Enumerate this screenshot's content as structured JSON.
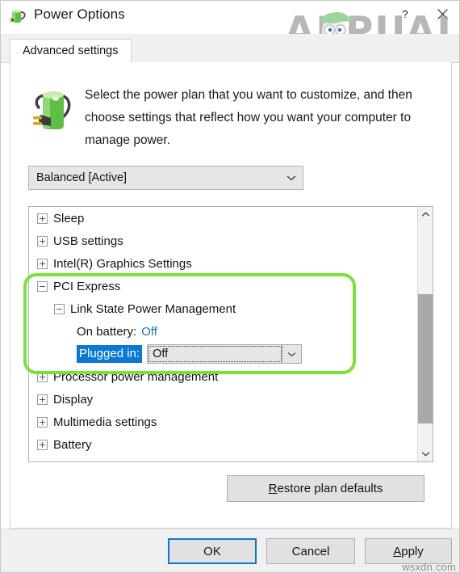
{
  "window": {
    "title": "Power Options",
    "title_icon": "battery-plug-icon",
    "help_button": "?",
    "close_button": "✕"
  },
  "watermark": {
    "text": "APPUALS",
    "face_icon": "appuals-mascot-icon",
    "color": "#9c9c9c",
    "hair_color": "#7ac27a"
  },
  "tabs": [
    {
      "label": "Advanced settings",
      "active": true
    }
  ],
  "header": {
    "icon": "battery-plug-large-icon",
    "description": "Select the power plan that you want to customize, and then choose settings that reflect how you want your computer to manage power."
  },
  "plan_select": {
    "value": "Balanced [Active]",
    "arrow_icon": "chevron-down-icon"
  },
  "tree": {
    "rows": [
      {
        "level": 0,
        "toggle": "plus",
        "label": "Sleep"
      },
      {
        "level": 0,
        "toggle": "plus",
        "label": "USB settings"
      },
      {
        "level": 0,
        "toggle": "plus",
        "label": "Intel(R) Graphics Settings"
      },
      {
        "level": 0,
        "toggle": "minus",
        "label": "PCI Express"
      },
      {
        "level": 1,
        "toggle": "minus",
        "label": "Link State Power Management"
      },
      {
        "level": 2,
        "toggle": "none",
        "label": "On battery:",
        "value": "Off",
        "value_style": "blue"
      },
      {
        "level": 2,
        "toggle": "none",
        "label": "Plugged in:",
        "selected": true,
        "combo_value": "Off",
        "combo_arrow": "chevron-down-icon"
      },
      {
        "level": 0,
        "toggle": "plus",
        "label": "Processor power management"
      },
      {
        "level": 0,
        "toggle": "plus",
        "label": "Display"
      },
      {
        "level": 0,
        "toggle": "plus",
        "label": "Multimedia settings"
      },
      {
        "level": 0,
        "toggle": "plus",
        "label": "Battery"
      }
    ]
  },
  "scrollbar": {
    "up_icon": "chevron-up-icon",
    "down_icon": "chevron-down-icon",
    "thumb_color": "#a8a8a8"
  },
  "restore_button": {
    "accel": "R",
    "rest": "estore plan defaults"
  },
  "footer": {
    "ok": "OK",
    "cancel": "Cancel",
    "apply_accel": "A",
    "apply_rest": "pply",
    "site_watermark": "wsxdn.com",
    "focus_color": "#0a78d7"
  },
  "annotation": {
    "highlight_color": "#7ce03a"
  }
}
